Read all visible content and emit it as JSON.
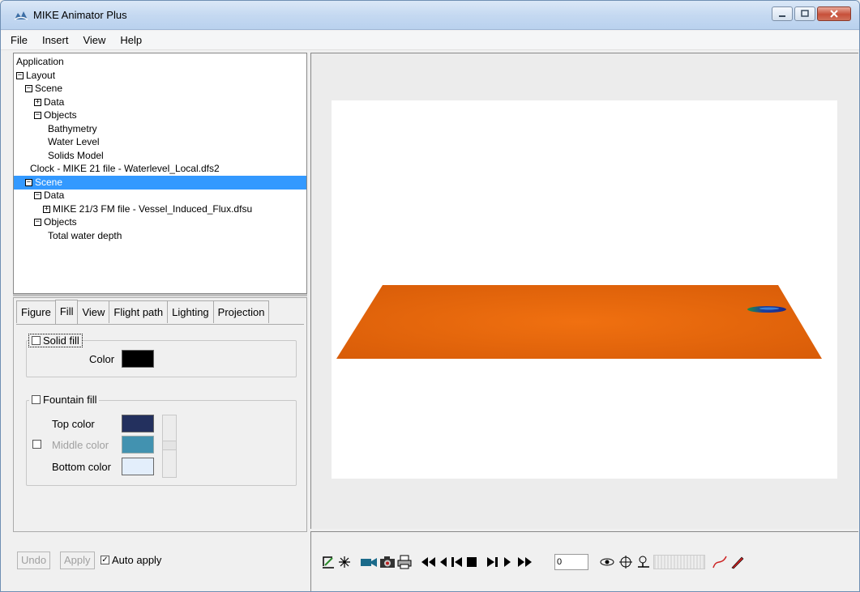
{
  "window": {
    "title": "MIKE Animator Plus"
  },
  "menu": [
    "File",
    "Insert",
    "View",
    "Help"
  ],
  "tree": [
    {
      "label": "Application",
      "indent": 0,
      "expander": ""
    },
    {
      "label": "Layout",
      "indent": 0,
      "expander": "−"
    },
    {
      "label": "Scene",
      "indent": 1,
      "expander": "−"
    },
    {
      "label": "Data",
      "indent": 2,
      "expander": "+"
    },
    {
      "label": "Objects",
      "indent": 2,
      "expander": "−"
    },
    {
      "label": "Bathymetry",
      "indent": 3,
      "expander": ""
    },
    {
      "label": "Water Level",
      "indent": 3,
      "expander": ""
    },
    {
      "label": "Solids Model",
      "indent": 3,
      "expander": ""
    },
    {
      "label": "Clock - MIKE 21 file - Waterlevel_Local.dfs2",
      "indent": 1,
      "expander": ""
    },
    {
      "label": "Scene",
      "indent": 1,
      "expander": "−",
      "selected": true
    },
    {
      "label": "Data",
      "indent": 2,
      "expander": "−"
    },
    {
      "label": "MIKE 21/3 FM file - Vessel_Induced_Flux.dfsu",
      "indent": 3,
      "expander": "+"
    },
    {
      "label": "Objects",
      "indent": 2,
      "expander": "−"
    },
    {
      "label": "Total water depth",
      "indent": 3,
      "expander": ""
    }
  ],
  "tabs": [
    "Figure",
    "Fill",
    "View",
    "Flight path",
    "Lighting",
    "Projection"
  ],
  "active_tab": "Fill",
  "fill": {
    "solid_fill": {
      "label": "Solid fill",
      "checked": false,
      "color_label": "Color",
      "color": "#000000"
    },
    "fountain_fill": {
      "label": "Fountain fill",
      "checked": false,
      "top_color_label": "Top color",
      "top_color": "#23305e",
      "middle_color_label": "Middle color",
      "middle_color": "#4292b0",
      "middle_checked": false,
      "bottom_color_label": "Bottom color",
      "bottom_color": "#e3eefb"
    }
  },
  "buttons": {
    "undo": "Undo",
    "apply": "Apply",
    "auto_apply": "Auto apply",
    "auto_apply_checked": true
  },
  "toolbar": {
    "frame_value": "0",
    "icons": [
      "edit-layout-icon",
      "star-icon",
      "record-video-icon",
      "camera-icon",
      "print-icon",
      "first-frame-icon",
      "step-back-icon",
      "previous-frame-icon",
      "stop-icon",
      "next-frame-icon",
      "step-forward-icon",
      "last-frame-icon",
      "view-icon",
      "target-icon",
      "navigate-icon",
      "path-icon",
      "pen-icon"
    ]
  },
  "colors": {
    "terrain": "#ee6a08",
    "selection": "#3399ff"
  }
}
